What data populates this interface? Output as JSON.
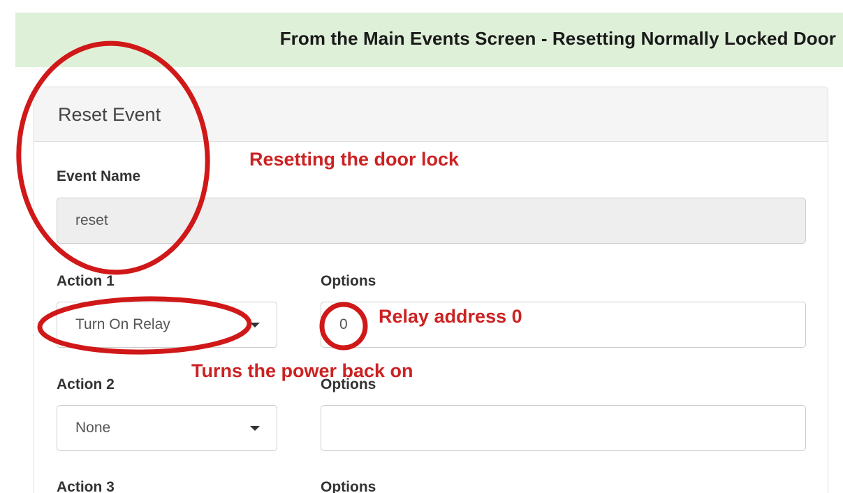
{
  "banner": {
    "title": "From the Main Events Screen - Resetting Normally Locked Door"
  },
  "panel": {
    "title": "Reset Event"
  },
  "event_name": {
    "label": "Event Name",
    "value": "reset"
  },
  "actions": [
    {
      "label": "Action 1",
      "selected": "Turn On Relay",
      "options_label": "Options",
      "options_value": "0"
    },
    {
      "label": "Action 2",
      "selected": "None",
      "options_label": "Options",
      "options_value": ""
    },
    {
      "label": "Action 3",
      "options_label": "Options"
    }
  ],
  "annotations": {
    "heading_note": "Resetting the door lock",
    "relay_note": "Relay address 0",
    "power_note": "Turns the power back on",
    "color": "#cc2222"
  },
  "colors": {
    "banner_bg": "#dff0d8",
    "panel_heading_bg": "#f5f5f5",
    "disabled_input_bg": "#eeeeee",
    "annotation_red": "#cc2222"
  }
}
